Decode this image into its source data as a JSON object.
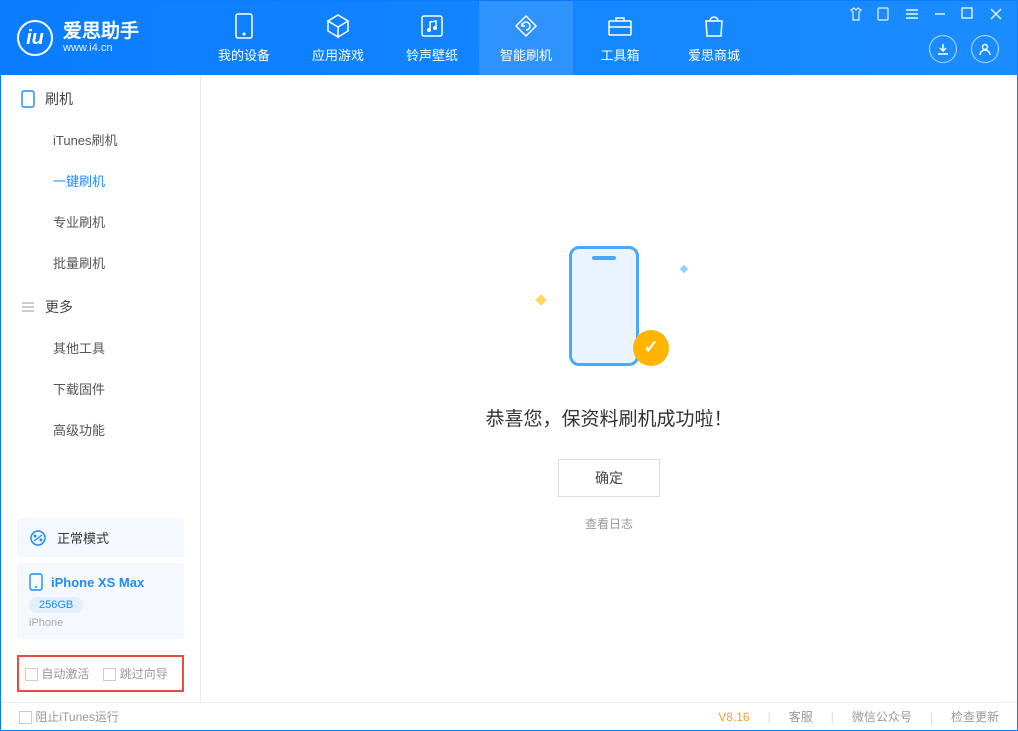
{
  "app": {
    "name_cn": "爱思助手",
    "url": "www.i4.cn"
  },
  "tabs": [
    {
      "label": "我的设备"
    },
    {
      "label": "应用游戏"
    },
    {
      "label": "铃声壁纸"
    },
    {
      "label": "智能刷机"
    },
    {
      "label": "工具箱"
    },
    {
      "label": "爱思商城"
    }
  ],
  "sidebar": {
    "group1": {
      "title": "刷机",
      "items": [
        "iTunes刷机",
        "一键刷机",
        "专业刷机",
        "批量刷机"
      ]
    },
    "group2": {
      "title": "更多",
      "items": [
        "其他工具",
        "下载固件",
        "高级功能"
      ]
    }
  },
  "mode": {
    "label": "正常模式"
  },
  "device": {
    "name": "iPhone XS Max",
    "capacity": "256GB",
    "type": "iPhone"
  },
  "options": {
    "auto_activate": "自动激活",
    "skip_guide": "跳过向导"
  },
  "main": {
    "title": "恭喜您，保资料刷机成功啦！",
    "ok": "确定",
    "log": "查看日志"
  },
  "status": {
    "block_itunes": "阻止iTunes运行",
    "version": "V8.16",
    "support": "客服",
    "wechat": "微信公众号",
    "update": "检查更新"
  }
}
